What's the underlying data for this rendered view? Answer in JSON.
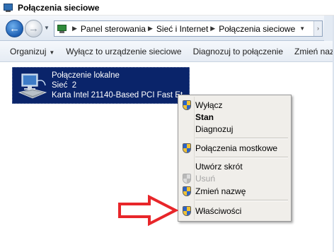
{
  "window": {
    "title": "Połączenia sieciowe",
    "title_icon": "network-connections-icon"
  },
  "address_bar": {
    "back_icon": "back-arrow-icon",
    "forward_icon": "forward-arrow-icon",
    "breadcrumbs": [
      "Panel sterowania",
      "Sieć i Internet",
      "Połączenia sieciowe"
    ]
  },
  "toolbar": {
    "items": [
      {
        "label": "Organizuj",
        "has_dropdown": true
      },
      {
        "label": "Wyłącz to urządzenie sieciowe",
        "has_dropdown": false
      },
      {
        "label": "Diagnozuj to połączenie",
        "has_dropdown": false
      },
      {
        "label": "Zmień nazwę teg",
        "has_dropdown": false
      }
    ]
  },
  "connection": {
    "name": "Połączenie lokalne",
    "network": "Sieć  2",
    "adapter": "Karta Intel 21140-Based PCI Fast Et...",
    "icon": "network-adapter-icon",
    "selected": true
  },
  "context_menu": {
    "items": [
      {
        "label": "Wyłącz",
        "icon": "uac-shield-icon",
        "bold": false,
        "disabled": false
      },
      {
        "label": "Stan",
        "icon": "",
        "bold": true,
        "disabled": false
      },
      {
        "label": "Diagnozuj",
        "icon": "",
        "bold": false,
        "disabled": false
      },
      {
        "label": "Połączenia mostkowe",
        "icon": "uac-shield-icon",
        "bold": false,
        "disabled": false
      },
      {
        "label": "Utwórz skrót",
        "icon": "",
        "bold": false,
        "disabled": false
      },
      {
        "label": "Usuń",
        "icon": "uac-shield-icon",
        "bold": false,
        "disabled": true
      },
      {
        "label": "Zmień nazwę",
        "icon": "uac-shield-icon",
        "bold": false,
        "disabled": false
      },
      {
        "label": "Właściwości",
        "icon": "uac-shield-icon",
        "bold": false,
        "disabled": false
      }
    ]
  },
  "annotation": {
    "arrow_color": "#e8262a",
    "points_to": "Właściwości"
  },
  "colors": {
    "selection": "#0a246a",
    "menu_background": "#f0eeea",
    "disabled_text": "#a3a3a3"
  }
}
